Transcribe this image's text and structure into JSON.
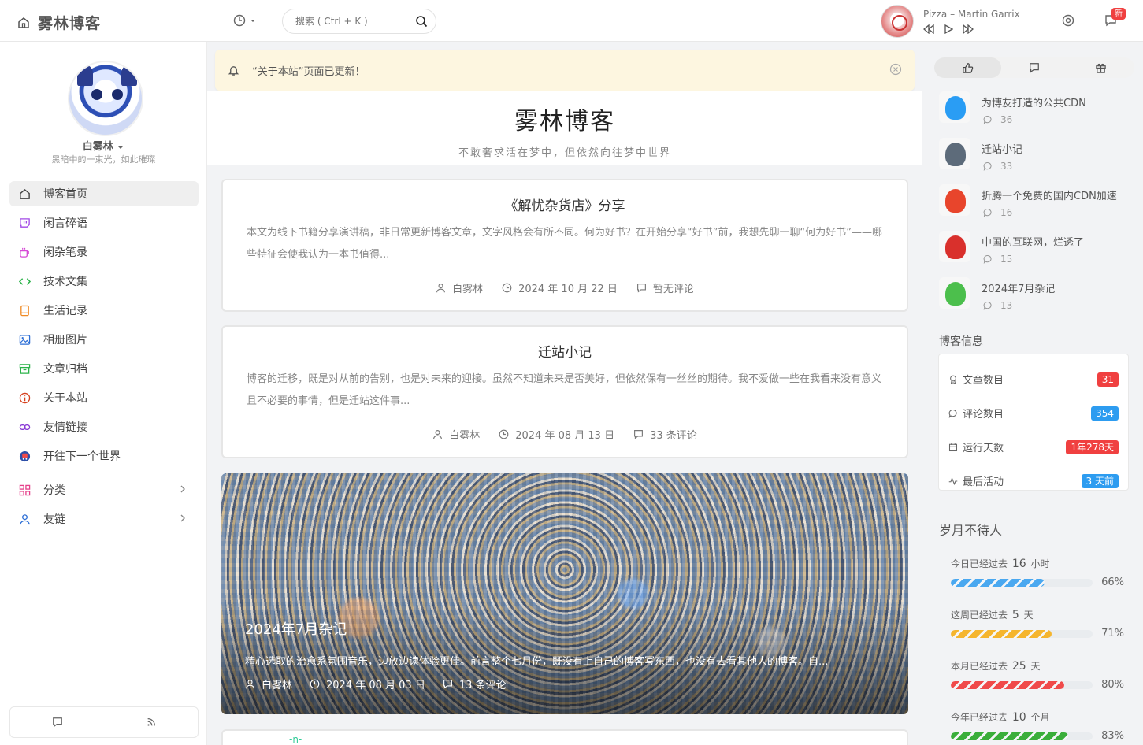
{
  "header": {
    "brand": "雾林博客",
    "search_placeholder": "搜索 ( Ctrl + K )",
    "song": "Pizza – Martin Garrix",
    "badge": "新"
  },
  "sidebar": {
    "username": "白雾林",
    "motto": "黑暗中的一束光，如此璀璨",
    "items": [
      {
        "label": "博客首页"
      },
      {
        "label": "闲言碎语"
      },
      {
        "label": "闲杂笔录"
      },
      {
        "label": "技术文集"
      },
      {
        "label": "生活记录"
      },
      {
        "label": "相册图片"
      },
      {
        "label": "文章归档"
      },
      {
        "label": "关于本站"
      },
      {
        "label": "友情链接"
      },
      {
        "label": "开往下一个世界"
      },
      {
        "label": "分类"
      },
      {
        "label": "友链"
      }
    ]
  },
  "notice": {
    "text": "“关于本站”页面已更新！"
  },
  "hero": {
    "title": "雾林博客",
    "subtitle": "不敢奢求活在梦中，但依然向往梦中世界"
  },
  "posts": [
    {
      "title": "《解忧杂货店》分享",
      "excerpt": "本文为线下书籍分享演讲稿，非日常更新博客文章，文字风格会有所不同。何为好书？在开始分享“好书”前，我想先聊一聊“何为好书”——哪些特征会使我认为一本书值得...",
      "author": "白雾林",
      "date": "2024 年 10 月 22 日",
      "comments": "暂无评论"
    },
    {
      "title": "迁站小记",
      "excerpt": "博客的迁移，既是对从前的告别，也是对未来的迎接。虽然不知道未来是否美好，但依然保有一丝丝的期待。我不爱做一些在我看来没有意义且不必要的事情，但是迁站这件事...",
      "author": "白雾林",
      "date": "2024 年 08 月 13 日",
      "comments": "33 条评论"
    }
  ],
  "feature": {
    "title": "2024年7月杂记",
    "excerpt": "精心选取的治愈系氛围音乐，边放边读体验更佳。前言整个七月份，既没有上自己的博客写东西，也没有去看其他人的博客。自...",
    "author": "白雾林",
    "date": "2024 年 08 月 03 日",
    "comments": "13 条评论"
  },
  "hot": [
    {
      "title": "为博友打造的公共CDN",
      "count": "36",
      "color": "#2a9df4"
    },
    {
      "title": "迁站小记",
      "count": "33",
      "color": "#5d6b7a"
    },
    {
      "title": "折腾一个免费的国内CDN加速",
      "count": "16",
      "color": "#e8452c"
    },
    {
      "title": "中国的互联网，烂透了",
      "count": "15",
      "color": "#d9302c"
    },
    {
      "title": "2024年7月杂记",
      "count": "13",
      "color": "#4cbf4c"
    }
  ],
  "blog_info": {
    "title": "博客信息",
    "rows": [
      {
        "label": "文章数目",
        "value": "31",
        "color": "#f04040"
      },
      {
        "label": "评论数目",
        "value": "354",
        "color": "#2d9cf0"
      },
      {
        "label": "运行天数",
        "value": "1年278天",
        "color": "#f04040"
      },
      {
        "label": "最后活动",
        "value": "3 天前",
        "color": "#2d9cf0"
      }
    ]
  },
  "time": {
    "title": "岁月不待人",
    "rows": [
      {
        "prefix": "今日已经过去",
        "num": "16",
        "unit": "小时",
        "pct": "66%",
        "fill": 0.66,
        "color": "#4aa8f0"
      },
      {
        "prefix": "这周已经过去",
        "num": "5",
        "unit": "天",
        "pct": "71%",
        "fill": 0.71,
        "color": "#f5b52e"
      },
      {
        "prefix": "本月已经过去",
        "num": "25",
        "unit": "天",
        "pct": "80%",
        "fill": 0.8,
        "color": "#f04a4a"
      },
      {
        "prefix": "今年已经过去",
        "num": "10",
        "unit": "个月",
        "pct": "83%",
        "fill": 0.83,
        "color": "#3aae3a"
      }
    ]
  }
}
